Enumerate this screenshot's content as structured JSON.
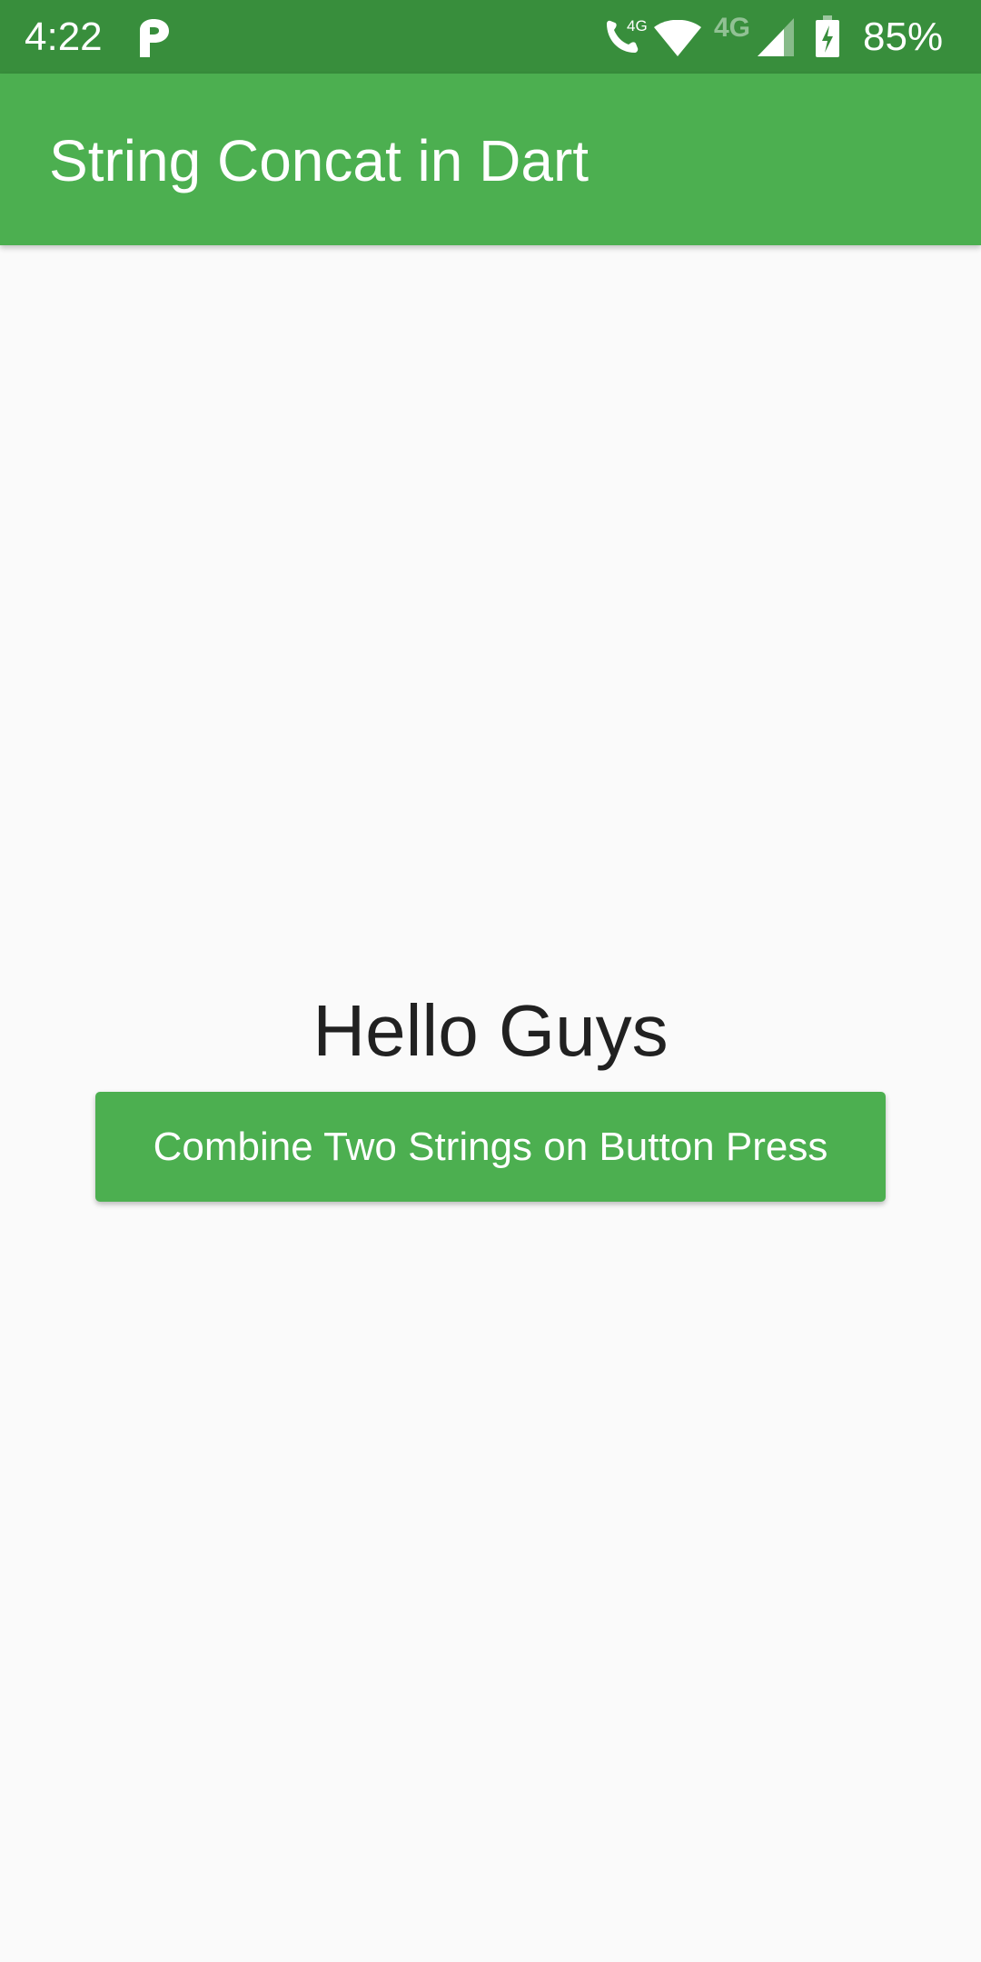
{
  "status_bar": {
    "time": "4:22",
    "notification_icon": "parking-p-icon",
    "call_icon": "volte-call-icon",
    "call_badge": "4G",
    "wifi_icon": "wifi-icon",
    "network_label": "4G",
    "signal_icon": "cell-signal-icon",
    "battery_icon": "battery-charging-icon",
    "battery_percent": "85%",
    "colors": {
      "background": "#388E3C",
      "foreground": "#FFFFFF"
    }
  },
  "app_bar": {
    "title": "String Concat in Dart",
    "color": "#4CAF50"
  },
  "body": {
    "background": "#FAFAFA",
    "message_text": "Hello Guys",
    "button_label": "Combine Two Strings on Button Press",
    "button_color": "#4CAF50"
  }
}
